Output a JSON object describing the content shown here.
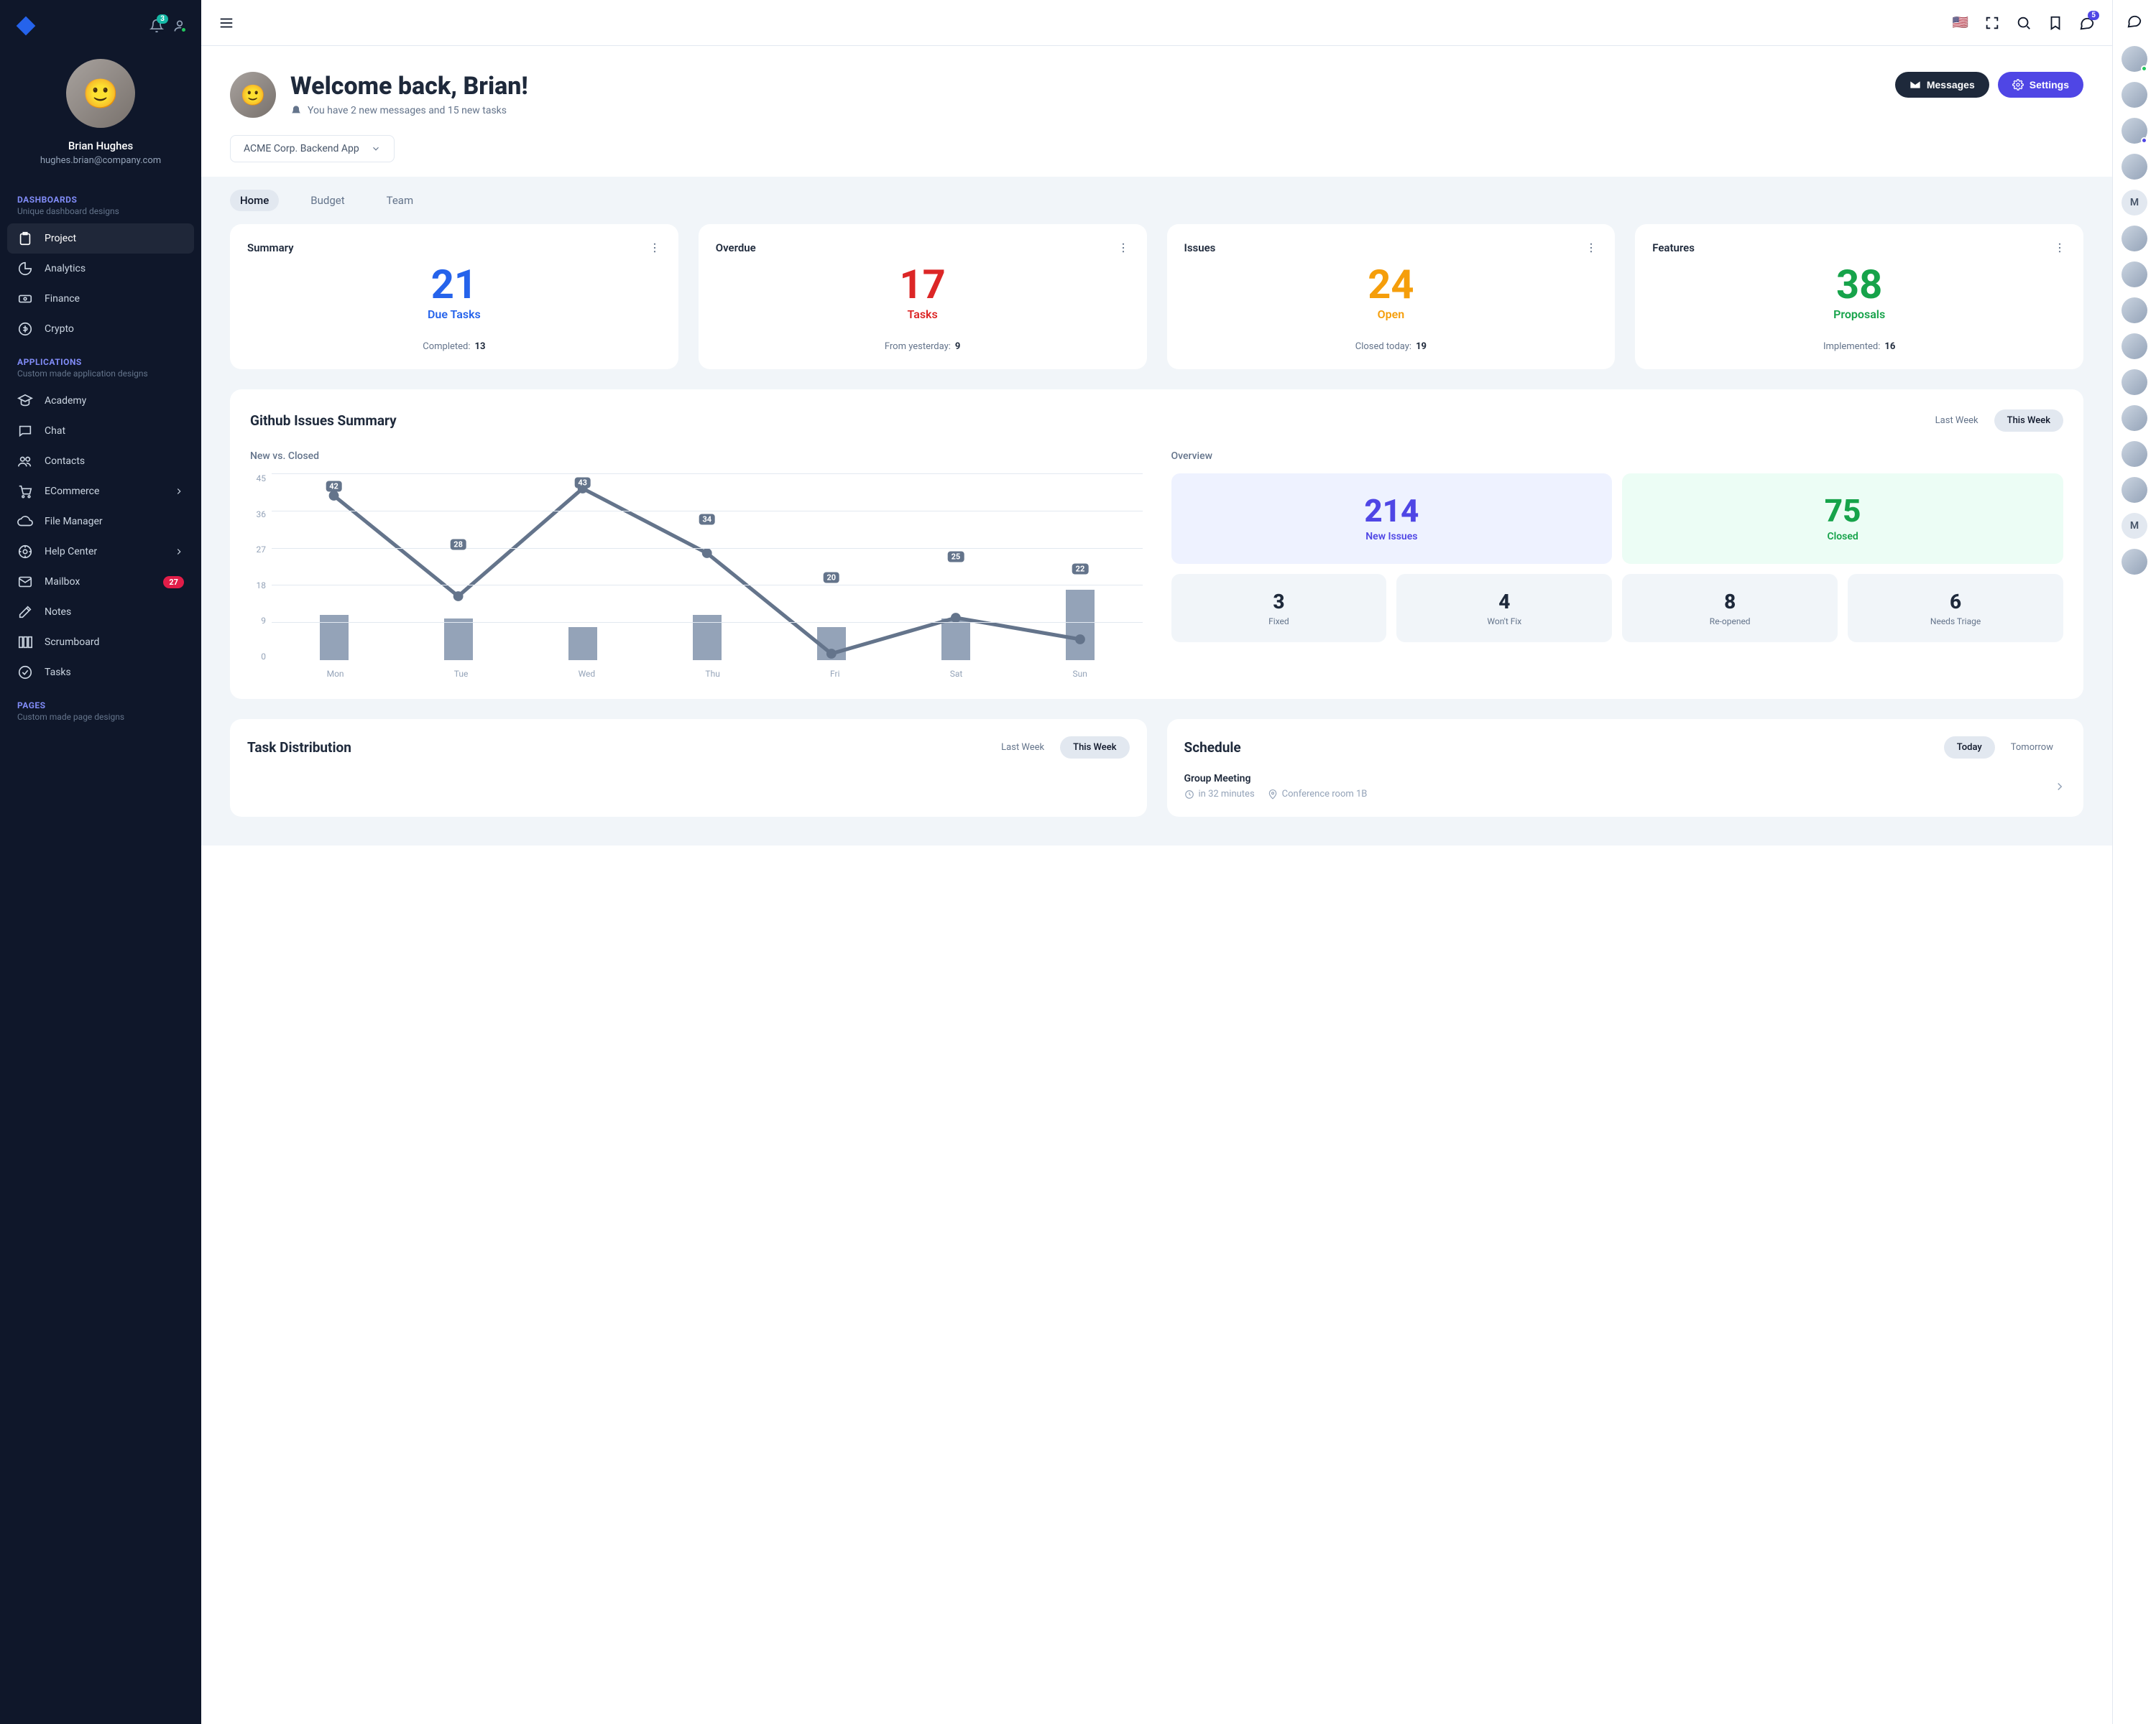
{
  "user": {
    "name": "Brian Hughes",
    "email": "hughes.brian@company.com",
    "bell_badge": "3"
  },
  "sidebar": {
    "sections": [
      {
        "title": "DASHBOARDS",
        "sub": "Unique dashboard designs",
        "items": [
          {
            "label": "Project",
            "active": true,
            "icon": "clipboard"
          },
          {
            "label": "Analytics",
            "active": false,
            "icon": "chart-pie"
          },
          {
            "label": "Finance",
            "active": false,
            "icon": "cash"
          },
          {
            "label": "Crypto",
            "active": false,
            "icon": "dollar-circle"
          }
        ]
      },
      {
        "title": "APPLICATIONS",
        "sub": "Custom made application designs",
        "items": [
          {
            "label": "Academy",
            "icon": "academic"
          },
          {
            "label": "Chat",
            "icon": "chat"
          },
          {
            "label": "Contacts",
            "icon": "users"
          },
          {
            "label": "ECommerce",
            "icon": "cart",
            "chevron": true
          },
          {
            "label": "File Manager",
            "icon": "cloud"
          },
          {
            "label": "Help Center",
            "icon": "support",
            "chevron": true
          },
          {
            "label": "Mailbox",
            "icon": "mail",
            "badge": "27"
          },
          {
            "label": "Notes",
            "icon": "pencil"
          },
          {
            "label": "Scrumboard",
            "icon": "columns"
          },
          {
            "label": "Tasks",
            "icon": "check"
          }
        ]
      },
      {
        "title": "PAGES",
        "sub": "Custom made page designs",
        "items": []
      }
    ]
  },
  "topbar": {
    "msg_badge": "5"
  },
  "header": {
    "welcome": "Welcome back, Brian!",
    "sub": "You have 2 new messages and 15 new tasks",
    "messages_btn": "Messages",
    "settings_btn": "Settings"
  },
  "project_selector": "ACME Corp. Backend App",
  "tabs": [
    {
      "label": "Home",
      "active": true
    },
    {
      "label": "Budget",
      "active": false
    },
    {
      "label": "Team",
      "active": false
    }
  ],
  "stats": [
    {
      "title": "Summary",
      "value": "21",
      "label": "Due Tasks",
      "footer_label": "Completed:",
      "footer_value": "13",
      "color": "#2563eb"
    },
    {
      "title": "Overdue",
      "value": "17",
      "label": "Tasks",
      "footer_label": "From yesterday:",
      "footer_value": "9",
      "color": "#dc2626"
    },
    {
      "title": "Issues",
      "value": "24",
      "label": "Open",
      "footer_label": "Closed today:",
      "footer_value": "19",
      "color": "#f59e0b"
    },
    {
      "title": "Features",
      "value": "38",
      "label": "Proposals",
      "footer_label": "Implemented:",
      "footer_value": "16",
      "color": "#16a34a"
    }
  ],
  "github": {
    "title": "Github Issues Summary",
    "filters": [
      {
        "label": "Last Week",
        "active": false
      },
      {
        "label": "This Week",
        "active": true
      }
    ],
    "left_title": "New vs. Closed",
    "right_title": "Overview",
    "overview": {
      "new": {
        "value": "214",
        "label": "New Issues",
        "color": "#4f46e5",
        "bg": "#eef2ff"
      },
      "closed": {
        "value": "75",
        "label": "Closed",
        "color": "#16a34a",
        "bg": "#ecfdf5"
      },
      "small": [
        {
          "value": "3",
          "label": "Fixed"
        },
        {
          "value": "4",
          "label": "Won't Fix"
        },
        {
          "value": "8",
          "label": "Re-opened"
        },
        {
          "value": "6",
          "label": "Needs Triage"
        }
      ]
    }
  },
  "task_dist": {
    "title": "Task Distribution",
    "filters": [
      {
        "label": "Last Week",
        "active": false
      },
      {
        "label": "This Week",
        "active": true
      }
    ]
  },
  "schedule": {
    "title": "Schedule",
    "filters": [
      {
        "label": "Today",
        "active": true
      },
      {
        "label": "Tomorrow",
        "active": false
      }
    ],
    "item": {
      "title": "Group Meeting",
      "time": "in 32 minutes",
      "room": "Conference room 1B"
    }
  },
  "rail_initials": [
    "",
    "",
    "",
    "",
    "M",
    "",
    "",
    "",
    "",
    "",
    "",
    "",
    "",
    "M",
    ""
  ],
  "rail_status": [
    "#22c55e",
    null,
    "#4f46e5",
    null,
    null,
    null,
    null,
    null,
    null,
    null,
    null,
    null,
    null,
    null,
    null
  ],
  "chart_data": {
    "type": "bar+line",
    "xlabel": "",
    "ylabel": "",
    "ylim": [
      0,
      45
    ],
    "y_ticks": [
      45,
      36,
      27,
      18,
      9,
      0
    ],
    "categories": [
      "Mon",
      "Tue",
      "Wed",
      "Thu",
      "Fri",
      "Sat",
      "Sun"
    ],
    "series": [
      {
        "name": "Closed (bars)",
        "type": "bar",
        "values": [
          11,
          10,
          8,
          11,
          8,
          10,
          17
        ]
      },
      {
        "name": "New (line)",
        "type": "line",
        "values": [
          42,
          28,
          43,
          34,
          20,
          25,
          22
        ]
      }
    ]
  }
}
